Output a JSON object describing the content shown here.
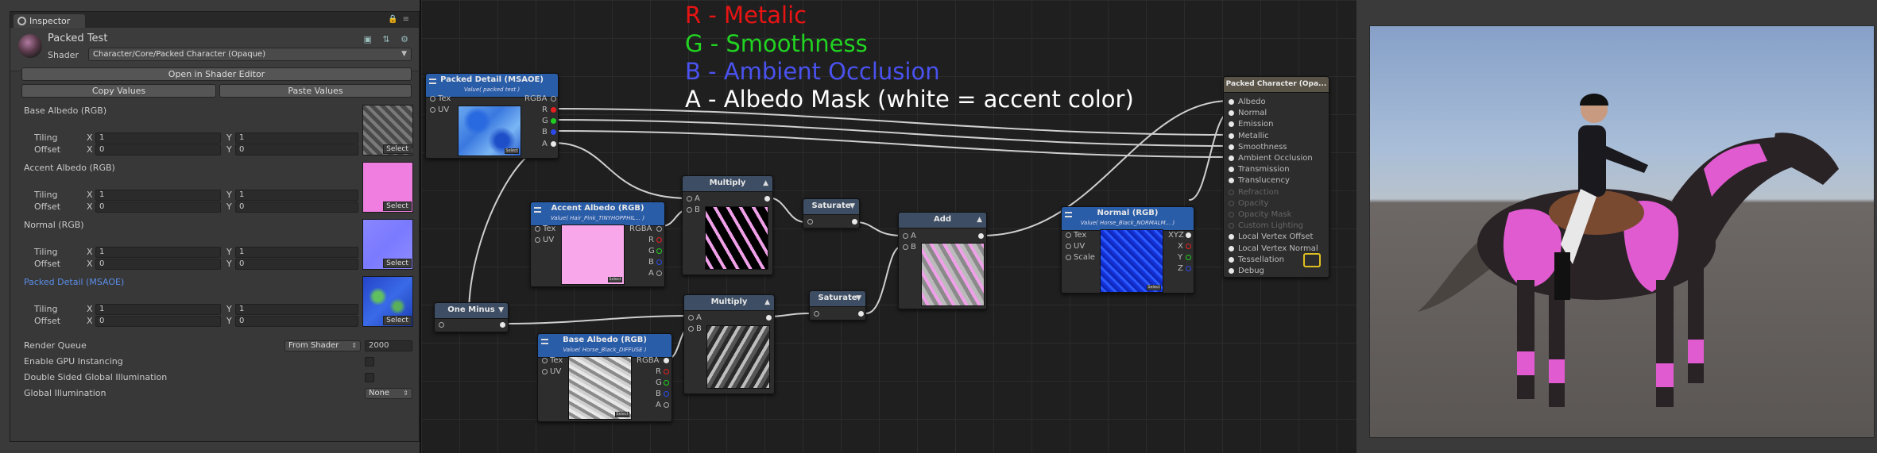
{
  "inspector": {
    "tab_label": "Inspector",
    "material_name": "Packed Test",
    "shader_label": "Shader",
    "shader_value": "Character/Core/Packed Character (Opaque)",
    "open_editor_label": "Open in Shader Editor",
    "copy_label": "Copy Values",
    "paste_label": "Paste Values",
    "tiling_label": "Tiling",
    "offset_label": "Offset",
    "x_label": "X",
    "y_label": "Y",
    "select_label": "Select",
    "textures": [
      {
        "label": "Base Albedo (RGB)",
        "tiling_x": "1",
        "tiling_y": "1",
        "offset_x": "0",
        "offset_y": "0"
      },
      {
        "label": "Accent Albedo  (RGB)",
        "tiling_x": "1",
        "tiling_y": "1",
        "offset_x": "0",
        "offset_y": "0"
      },
      {
        "label": "Normal (RGB)",
        "tiling_x": "1",
        "tiling_y": "1",
        "offset_x": "0",
        "offset_y": "0"
      },
      {
        "label": "Packed Detail (MSAOE)",
        "tiling_x": "1",
        "tiling_y": "1",
        "offset_x": "0",
        "offset_y": "0"
      }
    ],
    "render_queue_label": "Render Queue",
    "render_queue_mode": "From Shader",
    "render_queue_value": "2000",
    "gpu_instancing_label": "Enable GPU Instancing",
    "double_sided_gi_label": "Double Sided Global Illumination",
    "global_illumination_label": "Global Illumination",
    "global_illumination_value": "None"
  },
  "legend": {
    "r": "R - Metalic",
    "g": "G - Smoothness",
    "b": "B - Ambient Occlusion",
    "a": "A - Albedo Mask (white = accent color)",
    "colors": {
      "r": "#e81414",
      "g": "#21d421",
      "b": "#4a52f0",
      "a": "#ffffff"
    }
  },
  "nodes": {
    "packed_detail": {
      "title": "Packed Detail (MSAOE)",
      "subtitle": "Value( packed test )",
      "ports_in": [
        "Tex",
        "UV"
      ],
      "ports_out": [
        "RGBA",
        "R",
        "G",
        "B",
        "A"
      ],
      "preview_btn": "Select"
    },
    "accent_albedo": {
      "title": "Accent Albedo  (RGB)",
      "subtitle": "Value( Hair_Pink_TINYHOPPHIL... )",
      "ports_in": [
        "Tex",
        "UV"
      ],
      "ports_out": [
        "RGBA",
        "R",
        "G",
        "B",
        "A"
      ],
      "preview_btn": "Select"
    },
    "base_albedo": {
      "title": "Base Albedo (RGB)",
      "subtitle": "Value( Horse_Black_DIFFUSE )",
      "ports_in": [
        "Tex",
        "UV"
      ],
      "ports_out": [
        "RGBA",
        "R",
        "G",
        "B",
        "A"
      ],
      "preview_btn": "Select"
    },
    "normal": {
      "title": "Normal (RGB)",
      "subtitle": "Value( Horse_Black_NORMALM... )",
      "ports_in": [
        "Tex",
        "UV",
        "Scale"
      ],
      "ports_out": [
        "XYZ",
        "X",
        "Y",
        "Z"
      ],
      "preview_btn": "Select"
    },
    "multiply1": {
      "title": "Multiply",
      "ports_in": [
        "A",
        "B"
      ]
    },
    "multiply2": {
      "title": "Multiply",
      "ports_in": [
        "A",
        "B"
      ]
    },
    "saturate1": {
      "title": "Saturate"
    },
    "saturate2": {
      "title": "Saturate"
    },
    "add": {
      "title": "Add",
      "ports_in": [
        "A",
        "B"
      ]
    },
    "one_minus": {
      "title": "One Minus"
    },
    "master": {
      "title": "Packed Character (Opa...",
      "ports": [
        "Albedo",
        "Normal",
        "Emission",
        "Metallic",
        "Smoothness",
        "Ambient Occlusion",
        "Transmission",
        "Translucency",
        "Refraction",
        "Opacity",
        "Opacity Mask",
        "Custom Lighting",
        "Local Vertex Offset",
        "Local Vertex Normal",
        "Tessellation",
        "Debug"
      ],
      "dim_ports": [
        8,
        9,
        10,
        11
      ]
    }
  }
}
